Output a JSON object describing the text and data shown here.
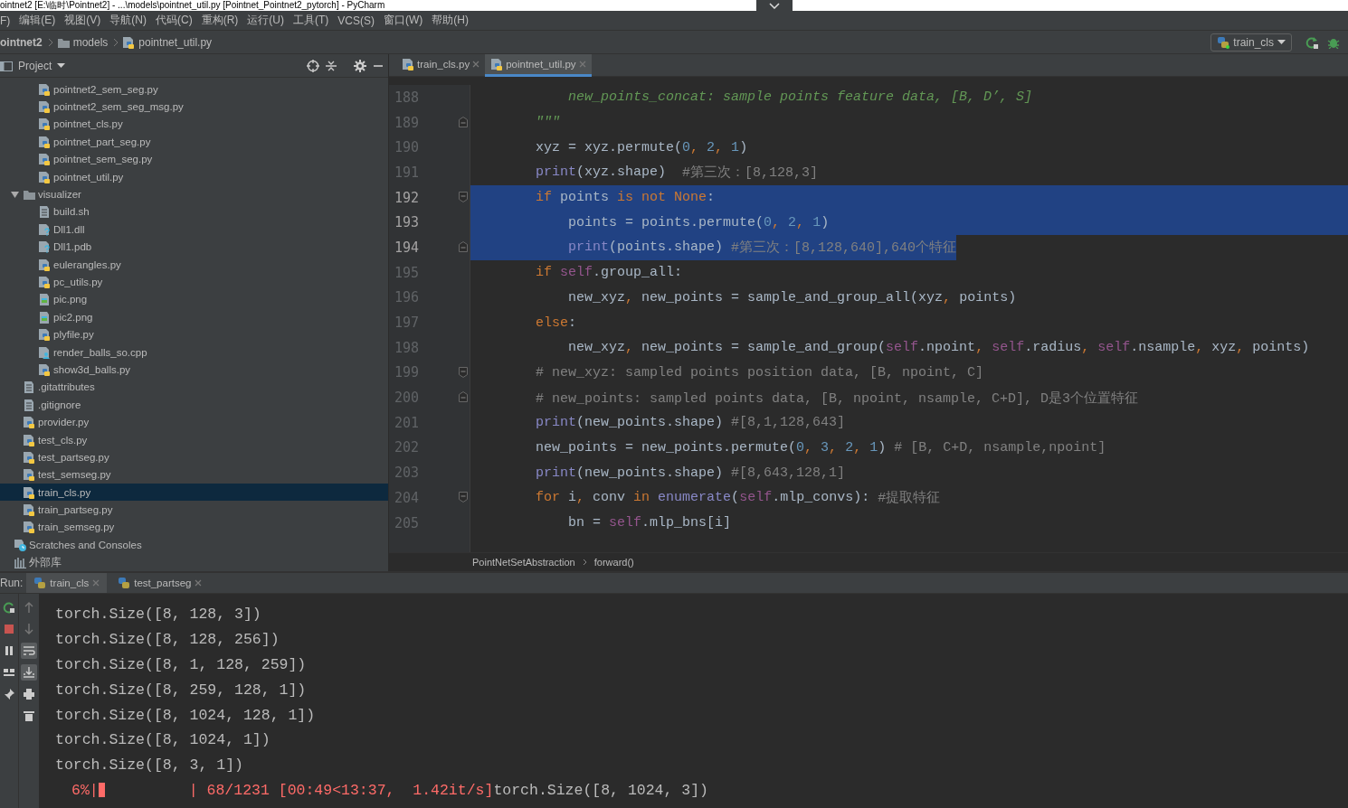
{
  "window": {
    "title": "ointnet2 [E:\\临时\\Pointnet2] - ...\\models\\pointnet_util.py [Pointnet_Pointnet2_pytorch] - PyCharm"
  },
  "menu": [
    "F)",
    "编辑(E)",
    "视图(V)",
    "导航(N)",
    "代码(C)",
    "重构(R)",
    "运行(U)",
    "工具(T)",
    "VCS(S)",
    "窗口(W)",
    "帮助(H)"
  ],
  "breadcrumbs": [
    {
      "label": "ointnet2",
      "kind": "project"
    },
    {
      "label": "models",
      "kind": "folder"
    },
    {
      "label": "pointnet_util.py",
      "kind": "py"
    }
  ],
  "run_config": {
    "label": "train_cls"
  },
  "project_panel": {
    "title": "Project",
    "hidden_parent_children": [
      {
        "label": "pointnet2_sem_seg.py",
        "kind": "py",
        "selected": false
      },
      {
        "label": "pointnet2_sem_seg_msg.py",
        "kind": "py",
        "selected": false
      },
      {
        "label": "pointnet_cls.py",
        "kind": "py",
        "selected": false
      },
      {
        "label": "pointnet_part_seg.py",
        "kind": "py",
        "selected": false
      },
      {
        "label": "pointnet_sem_seg.py",
        "kind": "py",
        "selected": false
      },
      {
        "label": "pointnet_util.py",
        "kind": "py",
        "selected": false
      }
    ],
    "project_items": [
      {
        "label": "visualizer",
        "kind": "folder",
        "expanded": true,
        "selected": false,
        "children": [
          {
            "label": "build.sh",
            "kind": "text",
            "selected": false
          },
          {
            "label": "Dll1.dll",
            "kind": "unknown",
            "selected": false
          },
          {
            "label": "Dll1.pdb",
            "kind": "unknown",
            "selected": false
          },
          {
            "label": "eulerangles.py",
            "kind": "py",
            "selected": false
          },
          {
            "label": "pc_utils.py",
            "kind": "py",
            "selected": false
          },
          {
            "label": "pic.png",
            "kind": "image",
            "selected": false
          },
          {
            "label": "pic2.png",
            "kind": "image",
            "selected": false
          },
          {
            "label": "plyfile.py",
            "kind": "py",
            "selected": false
          },
          {
            "label": "render_balls_so.cpp",
            "kind": "cpp",
            "selected": false
          },
          {
            "label": "show3d_balls.py",
            "kind": "py",
            "selected": false
          }
        ]
      },
      {
        "label": ".gitattributes",
        "kind": "text",
        "selected": false
      },
      {
        "label": ".gitignore",
        "kind": "text",
        "selected": false
      },
      {
        "label": "provider.py",
        "kind": "py",
        "selected": false
      },
      {
        "label": "test_cls.py",
        "kind": "py",
        "selected": false
      },
      {
        "label": "test_partseg.py",
        "kind": "py",
        "selected": false
      },
      {
        "label": "test_semseg.py",
        "kind": "py",
        "selected": false
      },
      {
        "label": "train_cls.py",
        "kind": "py",
        "selected": true
      },
      {
        "label": "train_partseg.py",
        "kind": "py",
        "selected": false
      },
      {
        "label": "train_semseg.py",
        "kind": "py",
        "selected": false
      }
    ],
    "root_items": [
      {
        "label": "Scratches and Consoles",
        "kind": "scratches",
        "selected": false
      },
      {
        "label": "外部库",
        "kind": "library",
        "selected": false
      }
    ]
  },
  "editor_tabs": [
    {
      "label": "train_cls.py",
      "selected": false
    },
    {
      "label": "pointnet_util.py",
      "selected": true
    }
  ],
  "code_lines": [
    {
      "number": "188",
      "selected": false,
      "kind": "code",
      "segments": [
        {
          "text": "            new_points_concat: sample points feature data, [B, D’, S]",
          "kind": "doc"
        }
      ]
    },
    {
      "number": "189",
      "selected": false,
      "kind": "foldend",
      "segments": [
        {
          "text": "        \"\"\"",
          "kind": "doc"
        }
      ]
    },
    {
      "number": "190",
      "selected": false,
      "kind": "code",
      "segments": [
        {
          "text": "        xyz = xyz.permute(",
          "kind": "plain"
        },
        {
          "text": "0",
          "kind": "num"
        },
        {
          "text": ", ",
          "kind": "kw"
        },
        {
          "text": "2",
          "kind": "num"
        },
        {
          "text": ", ",
          "kind": "kw"
        },
        {
          "text": "1",
          "kind": "num"
        },
        {
          "text": ")",
          "kind": "plain"
        }
      ]
    },
    {
      "number": "191",
      "selected": false,
      "kind": "code",
      "segments": [
        {
          "text": "        print",
          "kind": "builtin"
        },
        {
          "text": "(xyz.shape)  ",
          "kind": "plain"
        },
        {
          "text": "#第三次：[8,128,3]",
          "kind": "comment"
        }
      ]
    },
    {
      "number": "192",
      "selected": true,
      "kind": "foldstart",
      "segments": [
        {
          "text": "        if",
          "kind": "kw"
        },
        {
          "text": " points ",
          "kind": "plain"
        },
        {
          "text": "is not None",
          "kind": "kw"
        },
        {
          "text": ":",
          "kind": "plain"
        }
      ]
    },
    {
      "number": "193",
      "selected": true,
      "kind": "code",
      "segments": [
        {
          "text": "            points = points.permute(",
          "kind": "plain"
        },
        {
          "text": "0",
          "kind": "num"
        },
        {
          "text": ", ",
          "kind": "kw"
        },
        {
          "text": "2",
          "kind": "num"
        },
        {
          "text": ", ",
          "kind": "kw"
        },
        {
          "text": "1",
          "kind": "num"
        },
        {
          "text": ")",
          "kind": "plain"
        }
      ]
    },
    {
      "number": "194",
      "selected": true,
      "kind": "foldend",
      "segments": [
        {
          "text": "            print",
          "kind": "builtin"
        },
        {
          "text": "(points.shape) ",
          "kind": "plain"
        },
        {
          "text": "#第三次：[8,128,640],640个特征",
          "kind": "comment"
        }
      ]
    },
    {
      "number": "195",
      "selected": false,
      "kind": "code",
      "segments": [
        {
          "text": "        if ",
          "kind": "kw"
        },
        {
          "text": "self",
          "kind": "self"
        },
        {
          "text": ".group_all:",
          "kind": "plain"
        }
      ]
    },
    {
      "number": "196",
      "selected": false,
      "kind": "code",
      "segments": [
        {
          "text": "            new_xyz",
          "kind": "plain"
        },
        {
          "text": ", ",
          "kind": "kw"
        },
        {
          "text": "new_points = sample_and_group_all(xyz",
          "kind": "plain"
        },
        {
          "text": ", ",
          "kind": "kw"
        },
        {
          "text": "points)",
          "kind": "plain"
        }
      ]
    },
    {
      "number": "197",
      "selected": false,
      "kind": "code",
      "segments": [
        {
          "text": "        else",
          "kind": "kw"
        },
        {
          "text": ":",
          "kind": "plain"
        }
      ]
    },
    {
      "number": "198",
      "selected": false,
      "kind": "code",
      "segments": [
        {
          "text": "            new_xyz",
          "kind": "plain"
        },
        {
          "text": ", ",
          "kind": "kw"
        },
        {
          "text": "new_points = sample_and_group(",
          "kind": "plain"
        },
        {
          "text": "self",
          "kind": "self"
        },
        {
          "text": ".npoint",
          "kind": "plain"
        },
        {
          "text": ", ",
          "kind": "kw"
        },
        {
          "text": "self",
          "kind": "self"
        },
        {
          "text": ".radius",
          "kind": "plain"
        },
        {
          "text": ", ",
          "kind": "kw"
        },
        {
          "text": "self",
          "kind": "self"
        },
        {
          "text": ".nsample",
          "kind": "plain"
        },
        {
          "text": ", ",
          "kind": "kw"
        },
        {
          "text": "xyz",
          "kind": "plain"
        },
        {
          "text": ", ",
          "kind": "kw"
        },
        {
          "text": "points)",
          "kind": "plain"
        }
      ]
    },
    {
      "number": "199",
      "selected": false,
      "kind": "foldstart",
      "segments": [
        {
          "text": "        # new_xyz: sampled points position data, [B, npoint, C]",
          "kind": "comment"
        }
      ]
    },
    {
      "number": "200",
      "selected": false,
      "kind": "foldend",
      "segments": [
        {
          "text": "        # new_points: sampled points data, [B, npoint, nsample, C+D], D是3个位置特征",
          "kind": "comment"
        }
      ]
    },
    {
      "number": "201",
      "selected": false,
      "kind": "code",
      "segments": [
        {
          "text": "        print",
          "kind": "builtin"
        },
        {
          "text": "(new_points.shape) ",
          "kind": "plain"
        },
        {
          "text": "#[8,1,128,643]",
          "kind": "comment"
        }
      ]
    },
    {
      "number": "202",
      "selected": false,
      "kind": "code",
      "segments": [
        {
          "text": "        new_points = new_points.permute(",
          "kind": "plain"
        },
        {
          "text": "0",
          "kind": "num"
        },
        {
          "text": ", ",
          "kind": "kw"
        },
        {
          "text": "3",
          "kind": "num"
        },
        {
          "text": ", ",
          "kind": "kw"
        },
        {
          "text": "2",
          "kind": "num"
        },
        {
          "text": ", ",
          "kind": "kw"
        },
        {
          "text": "1",
          "kind": "num"
        },
        {
          "text": ") ",
          "kind": "plain"
        },
        {
          "text": "# [B, C+D, nsample,npoint]",
          "kind": "comment"
        }
      ]
    },
    {
      "number": "203",
      "selected": false,
      "kind": "code",
      "segments": [
        {
          "text": "        print",
          "kind": "builtin"
        },
        {
          "text": "(new_points.shape) ",
          "kind": "plain"
        },
        {
          "text": "#[8,643,128,1]",
          "kind": "comment"
        }
      ]
    },
    {
      "number": "204",
      "selected": false,
      "kind": "foldstart",
      "segments": [
        {
          "text": "        for",
          "kind": "kw"
        },
        {
          "text": " i",
          "kind": "plain"
        },
        {
          "text": ", ",
          "kind": "kw"
        },
        {
          "text": "conv ",
          "kind": "plain"
        },
        {
          "text": "in",
          "kind": "kw"
        },
        {
          "text": " enumerate",
          "kind": "builtin"
        },
        {
          "text": "(",
          "kind": "plain"
        },
        {
          "text": "self",
          "kind": "self"
        },
        {
          "text": ".mlp_convs): ",
          "kind": "plain"
        },
        {
          "text": "#提取特征",
          "kind": "comment"
        }
      ]
    },
    {
      "number": "205",
      "selected": false,
      "kind": "code",
      "segments": [
        {
          "text": "            bn = ",
          "kind": "plain"
        },
        {
          "text": "self",
          "kind": "self"
        },
        {
          "text": ".mlp_bns[i]",
          "kind": "plain"
        }
      ]
    }
  ],
  "editor_breadcrumbs": [
    "PointNetSetAbstraction",
    "forward()"
  ],
  "run_panel": {
    "label": "Run:",
    "tabs": [
      {
        "label": "train_cls",
        "selected": true
      },
      {
        "label": "test_partseg",
        "selected": false
      }
    ],
    "tools_left": [
      {
        "kind": "rerun"
      },
      {
        "kind": "stop"
      },
      {
        "kind": "pause"
      },
      {
        "kind": "layout"
      },
      {
        "kind": "pin"
      }
    ],
    "tools_right": [
      {
        "kind": "up",
        "on": false
      },
      {
        "kind": "down",
        "on": false
      },
      {
        "kind": "wrap",
        "on": true
      },
      {
        "kind": "scroll_end",
        "on": true
      },
      {
        "kind": "print",
        "on": false
      },
      {
        "kind": "trash",
        "on": false
      }
    ],
    "output": [
      "torch.Size([8, 128, 3])",
      "torch.Size([8, 128, 256])",
      "torch.Size([8, 1, 128, 259])",
      "torch.Size([8, 259, 128, 1])",
      "torch.Size([8, 1024, 128, 1])",
      "torch.Size([8, 1024, 1])",
      "torch.Size([8, 3, 1])"
    ],
    "progress": {
      "percent": "6%|",
      "level": 0.07,
      "stats": "| 68/1231 [00:49<13:37,  1.42it/s]",
      "tail": "torch.Size([8, 1024, 3])"
    }
  }
}
